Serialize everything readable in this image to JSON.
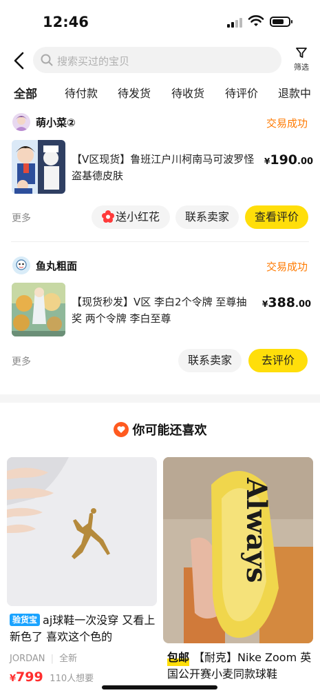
{
  "status_bar": {
    "time": "12:46"
  },
  "header": {
    "search_placeholder": "搜索买过的宝贝",
    "filter_label": "筛选"
  },
  "tabs": [
    "全部",
    "待付款",
    "待发货",
    "待收货",
    "待评价",
    "退款中"
  ],
  "orders": [
    {
      "shop": "萌小菜②",
      "status": "交易成功",
      "title": "【V区现货】鲁班江户川柯南马可波罗怪盗基德皮肤",
      "price_currency": "¥",
      "price_int": "190",
      "price_dec": ".00",
      "more": "更多",
      "buttons": [
        "送小红花",
        "联系卖家",
        "查看评价"
      ]
    },
    {
      "shop": "鱼丸粗面",
      "status": "交易成功",
      "title": "【现货秒发】V区 李白2个令牌 至尊抽奖 两个令牌 李白至尊",
      "price_currency": "¥",
      "price_int": "388",
      "price_dec": ".00",
      "more": "更多",
      "buttons": [
        "联系卖家",
        "去评价"
      ]
    }
  ],
  "recommend": {
    "title": "你可能还喜欢",
    "items": [
      {
        "tag": "验货宝",
        "text": "aj球鞋一次没穿 又看上新色了 喜欢这个色的",
        "brand": "JORDAN",
        "condition": "全新",
        "price_currency": "¥",
        "price": "799",
        "wants": "110人想要"
      },
      {
        "tag": "包邮",
        "text": "【耐克】Nike Zoom 英国公开赛小麦同款球鞋",
        "image_text": "Always"
      }
    ]
  },
  "colors": {
    "accent_yellow": "#ffde0a",
    "status_orange": "#ff7a00",
    "price_red": "#ff2d2d"
  }
}
